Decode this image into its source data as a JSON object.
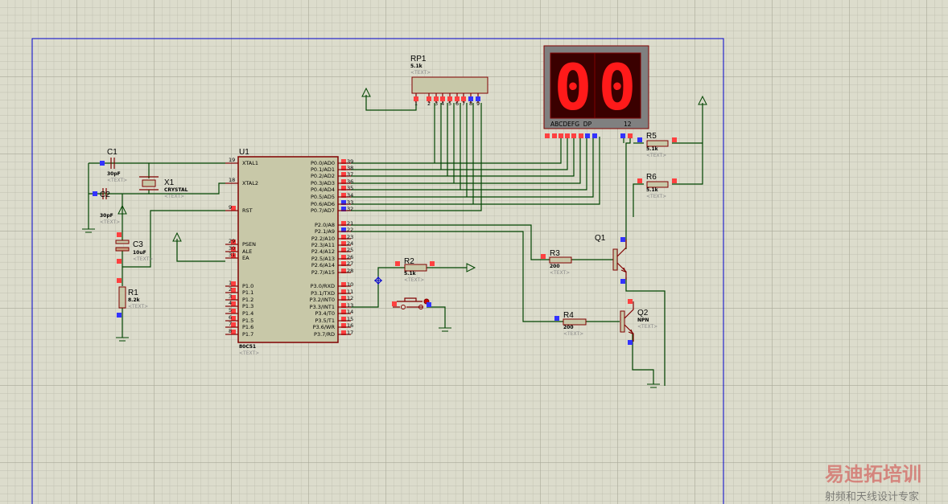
{
  "colors": {
    "background": "#dcdccc",
    "wire": "#004400",
    "component": "#800000",
    "body": "#c8c8a8",
    "pin_red": "#ff4040",
    "pin_blue": "#3333ff",
    "segment_on": "#ff1a1a",
    "border": "#0000cc"
  },
  "placeholder_text": "<TEXT>",
  "u1": {
    "ref": "U1",
    "part": "80C51",
    "left_pins": [
      [
        "19",
        "XTAL1"
      ],
      [
        "18",
        "XTAL2"
      ],
      [
        "9",
        "RST"
      ],
      [
        "29",
        "PSEN"
      ],
      [
        "30",
        "ALE"
      ],
      [
        "31",
        "EA"
      ],
      [
        "1",
        "P1.0"
      ],
      [
        "2",
        "P1.1"
      ],
      [
        "3",
        "P1.2"
      ],
      [
        "4",
        "P1.3"
      ],
      [
        "5",
        "P1.4"
      ],
      [
        "6",
        "P1.5"
      ],
      [
        "7",
        "P1.6"
      ],
      [
        "8",
        "P1.7"
      ]
    ],
    "right_pins": [
      [
        "39",
        "P0.0/AD0"
      ],
      [
        "38",
        "P0.1/AD1"
      ],
      [
        "37",
        "P0.2/AD2"
      ],
      [
        "36",
        "P0.3/AD3"
      ],
      [
        "35",
        "P0.4/AD4"
      ],
      [
        "34",
        "P0.5/AD5"
      ],
      [
        "33",
        "P0.6/AD6"
      ],
      [
        "32",
        "P0.7/AD7"
      ],
      [
        "21",
        "P2.0/A8"
      ],
      [
        "22",
        "P2.1/A9"
      ],
      [
        "23",
        "P2.2/A10"
      ],
      [
        "24",
        "P2.3/A11"
      ],
      [
        "25",
        "P2.4/A12"
      ],
      [
        "26",
        "P2.5/A13"
      ],
      [
        "27",
        "P2.6/A14"
      ],
      [
        "28",
        "P2.7/A15"
      ],
      [
        "10",
        "P3.0/RXD"
      ],
      [
        "11",
        "P3.1/TXD"
      ],
      [
        "12",
        "P3.2/INT0"
      ],
      [
        "13",
        "P3.3/INT1"
      ],
      [
        "14",
        "P3.4/T0"
      ],
      [
        "15",
        "P3.5/T1"
      ],
      [
        "16",
        "P3.6/WR"
      ],
      [
        "17",
        "P3.7/RD"
      ]
    ]
  },
  "components": {
    "c1": {
      "ref": "C1",
      "value": "30pF"
    },
    "c2": {
      "ref": "C2",
      "value": "30pF"
    },
    "c3": {
      "ref": "C3",
      "value": "10uF"
    },
    "x1": {
      "ref": "X1",
      "value": "CRYSTAL"
    },
    "r1": {
      "ref": "R1",
      "value": "8.2k"
    },
    "r2": {
      "ref": "R2",
      "value": "5.1k"
    },
    "r3": {
      "ref": "R3",
      "value": "200"
    },
    "r4": {
      "ref": "R4",
      "value": "200"
    },
    "r5": {
      "ref": "R5",
      "value": "5.1k"
    },
    "r6": {
      "ref": "R6",
      "value": "5.1k"
    },
    "rp1": {
      "ref": "RP1",
      "value": "5.1k",
      "pins": [
        "1",
        "2",
        "3",
        "4",
        "5",
        "6",
        "7",
        "8",
        "9"
      ]
    },
    "q1": {
      "ref": "Q1"
    },
    "q2": {
      "ref": "Q2",
      "value": "NPN"
    }
  },
  "display": {
    "digits": [
      "0",
      "0"
    ],
    "pin_labels": "ABCDEFG  DP",
    "common_labels": "12"
  },
  "watermark": {
    "line1": "易迪拓培训",
    "line2": "射频和天线设计专家"
  }
}
